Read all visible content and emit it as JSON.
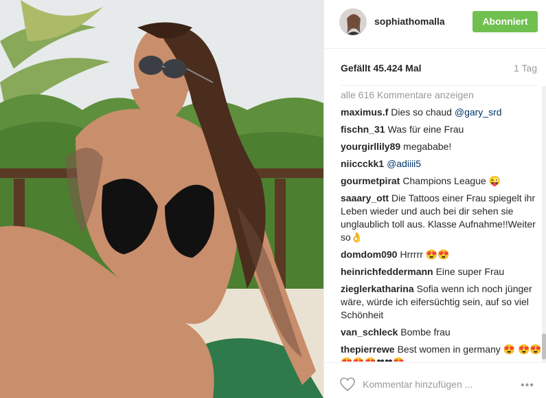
{
  "post": {
    "username": "sophiathomalla",
    "follow_label": "Abonniert",
    "likes_label": "Gefällt 45.424 Mal",
    "time_label": "1 Tag",
    "view_all_label": "alle 616 Kommentare anzeigen",
    "comment_placeholder": "Kommentar hinzufügen ...",
    "more_label": "•••"
  },
  "comments": [
    {
      "user": "maximus.f",
      "text": "Dies so chaud",
      "mention": "@gary_srd"
    },
    {
      "user": "fischn_31",
      "text": "Was für eine Frau",
      "mention": ""
    },
    {
      "user": "yourgirllily89",
      "text": "megababe!",
      "mention": ""
    },
    {
      "user": "niiccckk1",
      "text": "",
      "mention": "@adiiii5"
    },
    {
      "user": "gourmetpirat",
      "text": "Champions League 😜",
      "mention": ""
    },
    {
      "user": "saaary_ott",
      "text": "Die Tattoos einer Frau spiegelt ihr Leben wieder und auch bei dir sehen sie unglaublich toll aus. Klasse Aufnahme!!Weiter so👌",
      "mention": ""
    },
    {
      "user": "domdom090",
      "text": "Hrrrrr 😍😍",
      "mention": ""
    },
    {
      "user": "heinrichfeddermann",
      "text": "Eine super Frau",
      "mention": ""
    },
    {
      "user": "zieglerkatharina",
      "text": "Sofia wenn ich noch jünger wäre, würde ich eifersüchtig sein, auf so viel Schönheit",
      "mention": ""
    },
    {
      "user": "van_schleck",
      "text": "Bombe frau",
      "mention": ""
    },
    {
      "user": "thepierrewe",
      "text": "Best women in germany 😍 😍😍😍😍😍❤❤😍",
      "mention": ""
    }
  ],
  "icons": {
    "heart": "heart-icon",
    "more": "more-options-icon",
    "avatar": "avatar"
  },
  "colors": {
    "follow_button": "#70c050",
    "mention": "#003569",
    "muted": "#999999"
  }
}
